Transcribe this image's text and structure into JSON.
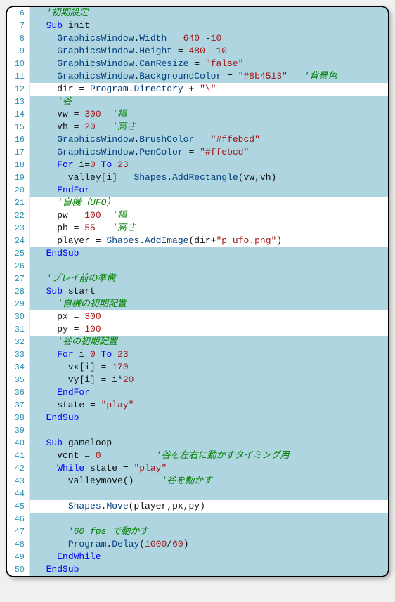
{
  "lines": [
    {
      "num": 6,
      "hl": true,
      "tokens": [
        [
          "txt",
          "  "
        ],
        [
          "com",
          "'初期設定"
        ]
      ]
    },
    {
      "num": 7,
      "hl": true,
      "tokens": [
        [
          "txt",
          "  "
        ],
        [
          "kw",
          "Sub"
        ],
        [
          "txt",
          " init"
        ]
      ]
    },
    {
      "num": 8,
      "hl": true,
      "tokens": [
        [
          "txt",
          "    "
        ],
        [
          "prop",
          "GraphicsWindow"
        ],
        [
          "op",
          "."
        ],
        [
          "prop",
          "Width"
        ],
        [
          "txt",
          " = "
        ],
        [
          "num",
          "640"
        ],
        [
          "txt",
          " -"
        ],
        [
          "num",
          "10"
        ]
      ]
    },
    {
      "num": 9,
      "hl": true,
      "tokens": [
        [
          "txt",
          "    "
        ],
        [
          "prop",
          "GraphicsWindow"
        ],
        [
          "op",
          "."
        ],
        [
          "prop",
          "Height"
        ],
        [
          "txt",
          " = "
        ],
        [
          "num",
          "480"
        ],
        [
          "txt",
          " -"
        ],
        [
          "num",
          "10"
        ]
      ]
    },
    {
      "num": 10,
      "hl": true,
      "tokens": [
        [
          "txt",
          "    "
        ],
        [
          "prop",
          "GraphicsWindow"
        ],
        [
          "op",
          "."
        ],
        [
          "prop",
          "CanResize"
        ],
        [
          "txt",
          " = "
        ],
        [
          "str",
          "\"false\""
        ]
      ]
    },
    {
      "num": 11,
      "hl": true,
      "tokens": [
        [
          "txt",
          "    "
        ],
        [
          "prop",
          "GraphicsWindow"
        ],
        [
          "op",
          "."
        ],
        [
          "prop",
          "BackgroundColor"
        ],
        [
          "txt",
          " = "
        ],
        [
          "str",
          "\"#8b4513\""
        ],
        [
          "txt",
          "   "
        ],
        [
          "com",
          "'背景色"
        ]
      ]
    },
    {
      "num": 12,
      "hl": false,
      "tokens": [
        [
          "txt",
          "    dir = "
        ],
        [
          "prop",
          "Program"
        ],
        [
          "op",
          "."
        ],
        [
          "prop",
          "Directory"
        ],
        [
          "txt",
          " + "
        ],
        [
          "str",
          "\"\\\""
        ]
      ]
    },
    {
      "num": 13,
      "hl": true,
      "tokens": [
        [
          "txt",
          "    "
        ],
        [
          "com",
          "'谷"
        ]
      ]
    },
    {
      "num": 14,
      "hl": true,
      "tokens": [
        [
          "txt",
          "    vw = "
        ],
        [
          "num",
          "300"
        ],
        [
          "txt",
          "  "
        ],
        [
          "com",
          "'幅"
        ]
      ]
    },
    {
      "num": 15,
      "hl": true,
      "tokens": [
        [
          "txt",
          "    vh = "
        ],
        [
          "num",
          "20"
        ],
        [
          "txt",
          "   "
        ],
        [
          "com",
          "'高さ"
        ]
      ]
    },
    {
      "num": 16,
      "hl": true,
      "tokens": [
        [
          "txt",
          "    "
        ],
        [
          "prop",
          "GraphicsWindow"
        ],
        [
          "op",
          "."
        ],
        [
          "prop",
          "BrushColor"
        ],
        [
          "txt",
          " = "
        ],
        [
          "str",
          "\"#ffebcd\""
        ]
      ]
    },
    {
      "num": 17,
      "hl": true,
      "tokens": [
        [
          "txt",
          "    "
        ],
        [
          "prop",
          "GraphicsWindow"
        ],
        [
          "op",
          "."
        ],
        [
          "prop",
          "PenColor"
        ],
        [
          "txt",
          " = "
        ],
        [
          "str",
          "\"#ffebcd\""
        ]
      ]
    },
    {
      "num": 18,
      "hl": true,
      "tokens": [
        [
          "txt",
          "    "
        ],
        [
          "kw",
          "For"
        ],
        [
          "txt",
          " i="
        ],
        [
          "num",
          "0"
        ],
        [
          "txt",
          " "
        ],
        [
          "kw",
          "To"
        ],
        [
          "txt",
          " "
        ],
        [
          "num",
          "23"
        ]
      ]
    },
    {
      "num": 19,
      "hl": true,
      "tokens": [
        [
          "txt",
          "      valley[i] = "
        ],
        [
          "prop",
          "Shapes"
        ],
        [
          "op",
          "."
        ],
        [
          "prop",
          "AddRectangle"
        ],
        [
          "txt",
          "(vw,vh)"
        ]
      ]
    },
    {
      "num": 20,
      "hl": true,
      "tokens": [
        [
          "txt",
          "    "
        ],
        [
          "kw",
          "EndFor"
        ]
      ]
    },
    {
      "num": 21,
      "hl": false,
      "tokens": [
        [
          "txt",
          "    "
        ],
        [
          "com",
          "'自機（UFO）"
        ]
      ]
    },
    {
      "num": 22,
      "hl": false,
      "tokens": [
        [
          "txt",
          "    pw = "
        ],
        [
          "num",
          "100"
        ],
        [
          "txt",
          "  "
        ],
        [
          "com",
          "'幅"
        ]
      ]
    },
    {
      "num": 23,
      "hl": false,
      "tokens": [
        [
          "txt",
          "    ph = "
        ],
        [
          "num",
          "55"
        ],
        [
          "txt",
          "   "
        ],
        [
          "com",
          "'高さ"
        ]
      ]
    },
    {
      "num": 24,
      "hl": false,
      "tokens": [
        [
          "txt",
          "    player = "
        ],
        [
          "prop",
          "Shapes"
        ],
        [
          "op",
          "."
        ],
        [
          "prop",
          "AddImage"
        ],
        [
          "txt",
          "(dir+"
        ],
        [
          "str",
          "\"p_ufo.png\""
        ],
        [
          "txt",
          ")"
        ]
      ]
    },
    {
      "num": 25,
      "hl": true,
      "tokens": [
        [
          "txt",
          "  "
        ],
        [
          "kw",
          "EndSub"
        ]
      ]
    },
    {
      "num": 26,
      "hl": true,
      "tokens": [
        [
          "txt",
          ""
        ]
      ]
    },
    {
      "num": 27,
      "hl": true,
      "tokens": [
        [
          "txt",
          "  "
        ],
        [
          "com",
          "'プレイ前の準備"
        ]
      ]
    },
    {
      "num": 28,
      "hl": true,
      "tokens": [
        [
          "txt",
          "  "
        ],
        [
          "kw",
          "Sub"
        ],
        [
          "txt",
          " start"
        ]
      ]
    },
    {
      "num": 29,
      "hl": true,
      "tokens": [
        [
          "txt",
          "    "
        ],
        [
          "com",
          "'自機の初期配置"
        ]
      ]
    },
    {
      "num": 30,
      "hl": false,
      "tokens": [
        [
          "txt",
          "    px = "
        ],
        [
          "num",
          "300"
        ]
      ]
    },
    {
      "num": 31,
      "hl": false,
      "tokens": [
        [
          "txt",
          "    py = "
        ],
        [
          "num",
          "100"
        ]
      ]
    },
    {
      "num": 32,
      "hl": true,
      "tokens": [
        [
          "txt",
          "    "
        ],
        [
          "com",
          "'谷の初期配置"
        ]
      ]
    },
    {
      "num": 33,
      "hl": true,
      "tokens": [
        [
          "txt",
          "    "
        ],
        [
          "kw",
          "For"
        ],
        [
          "txt",
          " i="
        ],
        [
          "num",
          "0"
        ],
        [
          "txt",
          " "
        ],
        [
          "kw",
          "To"
        ],
        [
          "txt",
          " "
        ],
        [
          "num",
          "23"
        ]
      ]
    },
    {
      "num": 34,
      "hl": true,
      "tokens": [
        [
          "txt",
          "      vx[i] = "
        ],
        [
          "num",
          "170"
        ]
      ]
    },
    {
      "num": 35,
      "hl": true,
      "tokens": [
        [
          "txt",
          "      vy[i] = i*"
        ],
        [
          "num",
          "20"
        ]
      ]
    },
    {
      "num": 36,
      "hl": true,
      "tokens": [
        [
          "txt",
          "    "
        ],
        [
          "kw",
          "EndFor"
        ]
      ]
    },
    {
      "num": 37,
      "hl": true,
      "tokens": [
        [
          "txt",
          "    state = "
        ],
        [
          "str",
          "\"play\""
        ]
      ]
    },
    {
      "num": 38,
      "hl": true,
      "tokens": [
        [
          "txt",
          "  "
        ],
        [
          "kw",
          "EndSub"
        ]
      ]
    },
    {
      "num": 39,
      "hl": true,
      "tokens": [
        [
          "txt",
          ""
        ]
      ]
    },
    {
      "num": 40,
      "hl": true,
      "tokens": [
        [
          "txt",
          "  "
        ],
        [
          "kw",
          "Sub"
        ],
        [
          "txt",
          " gameloop"
        ]
      ]
    },
    {
      "num": 41,
      "hl": true,
      "tokens": [
        [
          "txt",
          "    vcnt = "
        ],
        [
          "num",
          "0"
        ],
        [
          "txt",
          "          "
        ],
        [
          "com",
          "'谷を左右に動かすタイミング用"
        ]
      ]
    },
    {
      "num": 42,
      "hl": true,
      "tokens": [
        [
          "txt",
          "    "
        ],
        [
          "kw",
          "While"
        ],
        [
          "txt",
          " state = "
        ],
        [
          "str",
          "\"play\""
        ]
      ]
    },
    {
      "num": 43,
      "hl": true,
      "tokens": [
        [
          "txt",
          "      valleymove()     "
        ],
        [
          "com",
          "'谷を動かす"
        ]
      ]
    },
    {
      "num": 44,
      "hl": true,
      "tokens": [
        [
          "txt",
          ""
        ]
      ]
    },
    {
      "num": 45,
      "hl": false,
      "tokens": [
        [
          "txt",
          "      "
        ],
        [
          "prop",
          "Shapes"
        ],
        [
          "op",
          "."
        ],
        [
          "prop",
          "Move"
        ],
        [
          "txt",
          "(player,px,py)"
        ]
      ]
    },
    {
      "num": 46,
      "hl": true,
      "tokens": [
        [
          "txt",
          ""
        ]
      ]
    },
    {
      "num": 47,
      "hl": true,
      "tokens": [
        [
          "txt",
          "      "
        ],
        [
          "com",
          "'60 fps で動かす"
        ]
      ]
    },
    {
      "num": 48,
      "hl": true,
      "tokens": [
        [
          "txt",
          "      "
        ],
        [
          "prop",
          "Program"
        ],
        [
          "op",
          "."
        ],
        [
          "prop",
          "Delay"
        ],
        [
          "txt",
          "("
        ],
        [
          "num",
          "1000"
        ],
        [
          "txt",
          "/"
        ],
        [
          "num",
          "60"
        ],
        [
          "txt",
          ")"
        ]
      ]
    },
    {
      "num": 49,
      "hl": true,
      "tokens": [
        [
          "txt",
          "    "
        ],
        [
          "kw",
          "EndWhile"
        ]
      ]
    },
    {
      "num": 50,
      "hl": true,
      "tokens": [
        [
          "txt",
          "  "
        ],
        [
          "kw",
          "EndSub"
        ]
      ]
    }
  ]
}
